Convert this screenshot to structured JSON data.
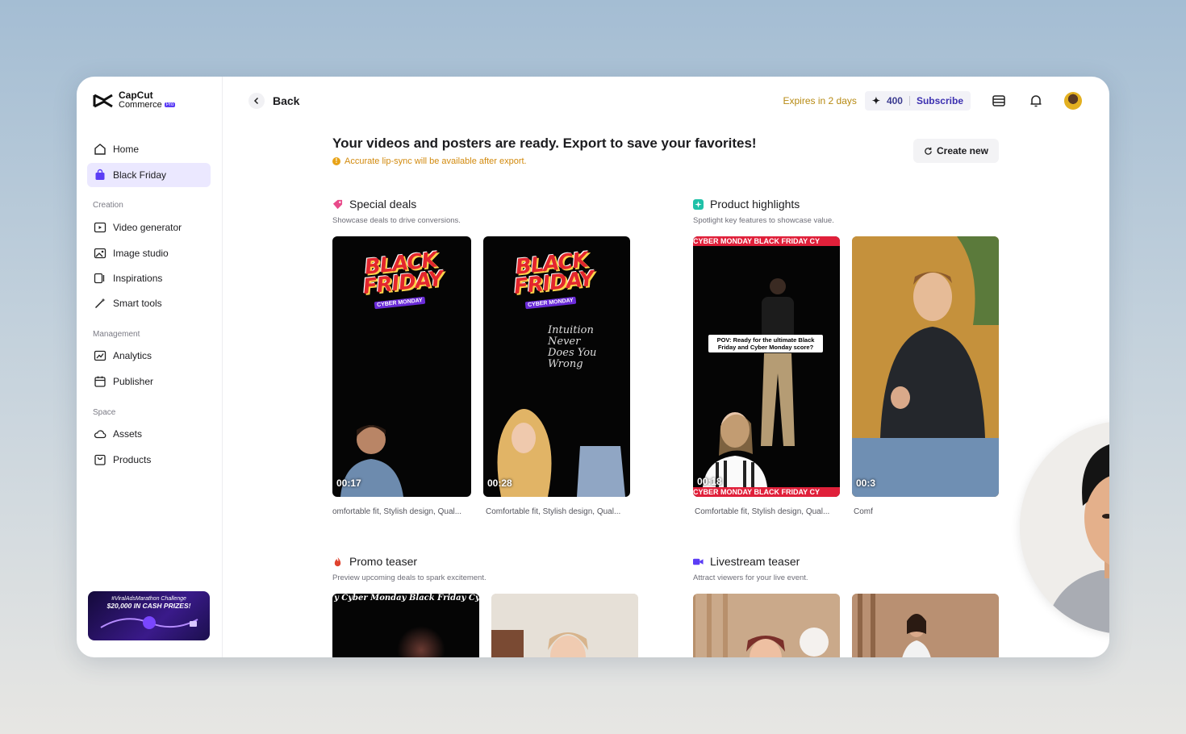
{
  "brand": {
    "name": "CapCut",
    "sub": "Commerce",
    "badge": "Pro"
  },
  "sidebar": {
    "items": [
      {
        "label": "Home"
      },
      {
        "label": "Black Friday"
      }
    ],
    "creation_heading": "Creation",
    "creation": [
      {
        "label": "Video generator"
      },
      {
        "label": "Image studio"
      },
      {
        "label": "Inspirations"
      },
      {
        "label": "Smart tools"
      }
    ],
    "management_heading": "Management",
    "management": [
      {
        "label": "Analytics"
      },
      {
        "label": "Publisher"
      }
    ],
    "space_heading": "Space",
    "space": [
      {
        "label": "Assets"
      },
      {
        "label": "Products"
      }
    ],
    "promo": {
      "line1": "#ViralAdsMarathon Challenge",
      "line2": "$20,000 IN CASH PRIZES!"
    }
  },
  "header": {
    "back_label": "Back",
    "expires": "Expires in 2 days",
    "credits": "400",
    "subscribe": "Subscribe"
  },
  "main": {
    "headline": "Your videos and posters are ready. Export to save your favorites!",
    "note": "Accurate lip-sync will be available after export.",
    "create_new": "Create new",
    "sections": [
      {
        "title": "Special deals",
        "desc": "Showcase deals to drive conversions.",
        "cards": [
          {
            "duration": "00:17",
            "caption": "omfortable fit, Stylish design, Qual...",
            "overlay": "BLACK FRIDAY",
            "tag": "CYBER MONDAY"
          },
          {
            "duration": "00:28",
            "caption": "Comfortable fit, Stylish design, Qual...",
            "overlay": "BLACK FRIDAY",
            "tag": "CYBER MONDAY",
            "shirt": "Intuition Never Does You Wrong"
          }
        ]
      },
      {
        "title": "Product highlights",
        "desc": "Spotlight key features to showcase value.",
        "cards": [
          {
            "duration": "00:18",
            "caption": "Comfortable fit, Stylish design, Qual...",
            "ticker": "CYBER MONDAY BLACK FRIDAY CY",
            "pov": "POV: Ready for the ultimate Black Friday and Cyber Monday score?"
          },
          {
            "duration": "00:3",
            "caption": "Comf"
          }
        ]
      },
      {
        "title": "Promo teaser",
        "desc": "Preview upcoming deals to spark excitement.",
        "cards": [
          {
            "ticker": "y Cyber Monday Black Friday Cy"
          },
          {}
        ]
      },
      {
        "title": "Livestream teaser",
        "desc": "Attract viewers for your live event.",
        "cards": [
          {},
          {}
        ]
      }
    ]
  },
  "colors": {
    "accent": "#5b3df5",
    "active_bg": "#ebe8ff",
    "warning": "#d28a0e",
    "expires": "#b78a13",
    "help": "#4b2fe0"
  }
}
